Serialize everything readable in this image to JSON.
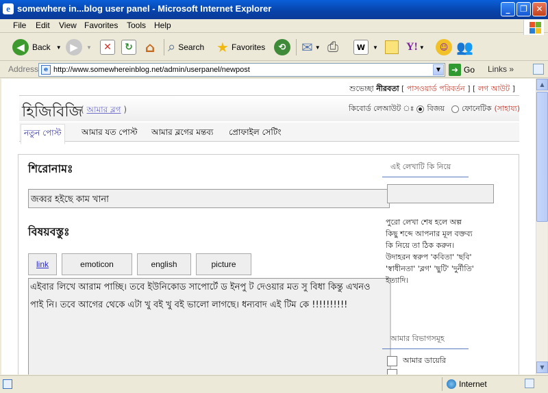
{
  "window": {
    "title": "somewhere in...blog user panel - Microsoft Internet Explorer"
  },
  "menu": [
    "File",
    "Edit",
    "View",
    "Favorites",
    "Tools",
    "Help"
  ],
  "toolbar": {
    "back": "Back",
    "search": "Search",
    "favorites": "Favorites"
  },
  "address": {
    "label": "Address",
    "url": "http://www.somewhereinblog.net/admin/userpanel/newpost",
    "go": "Go",
    "links": "Links"
  },
  "page": {
    "greeting": "শুভেচ্ছা",
    "username": "নীরবতা",
    "change_password": "পাসওয়ার্ড পরিবর্তন",
    "logout": "লগ আউট",
    "logo": "হিজিবিজি",
    "my_blog": "আমার ব্লগ",
    "keyboard_label": "কিবোর্ড লেআউট ঃ",
    "layout_bijoy": "বিজয়",
    "layout_phonetic": "ফোনেটিক",
    "help": "সাহায্য",
    "tabs": [
      "নতুন পোস্ট",
      "আমার যত পোস্ট",
      "আমার ব্লগের মন্তব্য",
      "প্রোফাইল সেটিং"
    ],
    "title_label": "শিরোনামঃ",
    "title_value": "জব্বর হইছে কাম খানা",
    "body_label": "বিষয়বস্তুঃ",
    "editor_buttons": [
      "link",
      "emoticon",
      "english",
      "picture"
    ],
    "body_value": "এইবার লিখে আরাম পাচ্ছি। তবে ইউনিকোড সাপোর্টে ড ইনপু ট দেওয়ার মত সু বিধা কিন্তু এখনও পাই নি। তবে আগের থেকে এটা খু বই খু বই ভালো লাগছে। ধন্যবাদ এই টিম কে !!!!!!!!!!",
    "sidebar_title": "এই লেখাটি কি নিয়ে",
    "sidebar_hint": "পুরো লেখা শেষ হলে অল্প কিছু শব্দে আপনার মূল বক্তব্য কি নিয়ে তা ঠিক করুন। উদাহরন স্বরুপ 'কবিতা' 'ছবি' 'স্বাধীনতা' 'ব্লগ' 'ছুটি' 'দুর্নীতি' ইত্যাদি।",
    "categories_title": "আমার বিভাগসমূহ",
    "categories": [
      "আমার ডায়েরি"
    ]
  },
  "status": {
    "zone": "Internet"
  }
}
